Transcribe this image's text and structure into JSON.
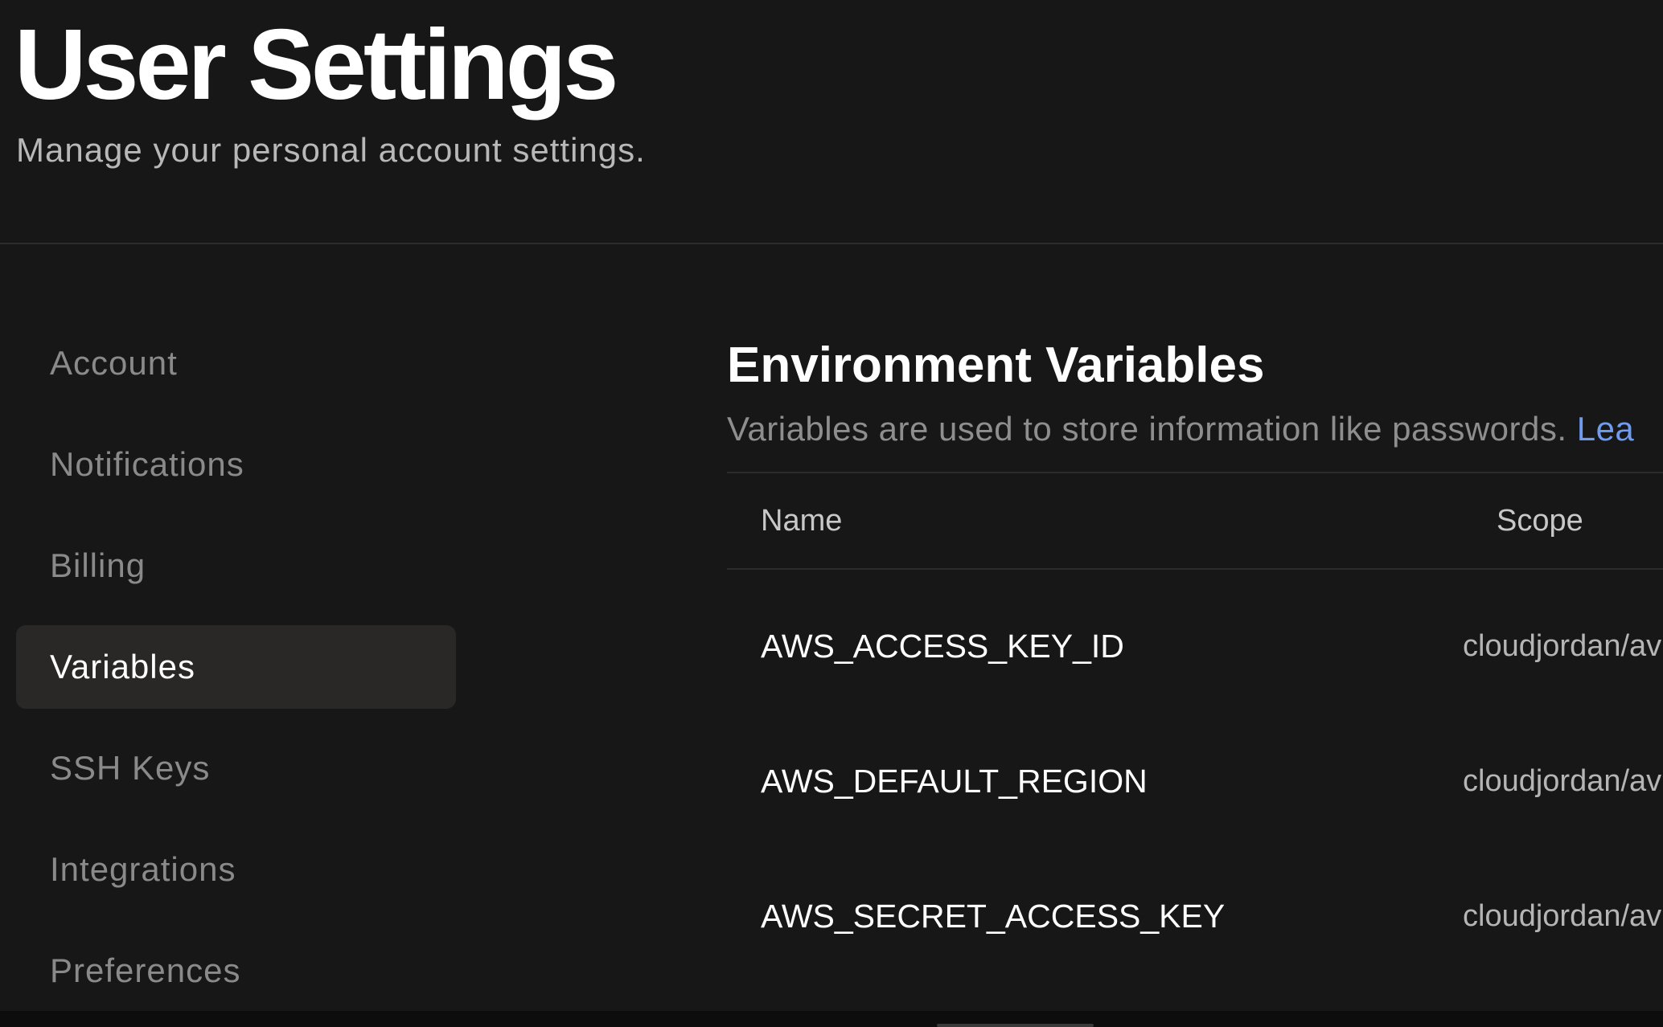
{
  "header": {
    "title": "User Settings",
    "subtitle": "Manage your personal account settings."
  },
  "sidebar": {
    "items": [
      {
        "label": "Account",
        "active": false
      },
      {
        "label": "Notifications",
        "active": false
      },
      {
        "label": "Billing",
        "active": false
      },
      {
        "label": "Variables",
        "active": true
      },
      {
        "label": "SSH Keys",
        "active": false
      },
      {
        "label": "Integrations",
        "active": false
      },
      {
        "label": "Preferences",
        "active": false
      }
    ]
  },
  "main": {
    "section_title": "Environment Variables",
    "section_description": "Variables are used to store information like passwords. ",
    "learn_link": "Lea",
    "table": {
      "columns": {
        "name": "Name",
        "scope": "Scope"
      },
      "rows": [
        {
          "name": "AWS_ACCESS_KEY_ID",
          "scope": "cloudjordan/av"
        },
        {
          "name": "AWS_DEFAULT_REGION",
          "scope": "cloudjordan/av"
        },
        {
          "name": "AWS_SECRET_ACCESS_KEY",
          "scope": "cloudjordan/av"
        }
      ]
    }
  },
  "colors": {
    "background": "#171717",
    "active_item_bg": "#2a2727",
    "link": "#6f9bf0",
    "muted_text": "#8a8a8a"
  }
}
